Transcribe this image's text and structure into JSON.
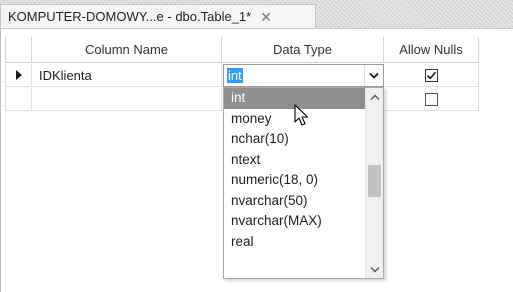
{
  "tab": {
    "title": "KOMPUTER-DOMOWY...e - dbo.Table_1*",
    "close_glyph": "✕"
  },
  "grid": {
    "headers": {
      "column_name": "Column Name",
      "data_type": "Data Type",
      "allow_nulls": "Allow Nulls"
    },
    "rows": [
      {
        "name": "IDKlienta",
        "data_type": "int",
        "allow_nulls": true,
        "current": true
      },
      {
        "name": "",
        "data_type": "",
        "allow_nulls": false,
        "current": false
      }
    ]
  },
  "dropdown": {
    "items": [
      "int",
      "money",
      "nchar(10)",
      "ntext",
      "numeric(18, 0)",
      "nvarchar(50)",
      "nvarchar(MAX)",
      "real"
    ],
    "highlighted": "int",
    "scroll_position": 0.48
  },
  "icons": {
    "row_indicator": "current-row-arrow-icon",
    "dropdown": "chevron-down-icon",
    "check": "checkmark-icon",
    "cursor": "mouse-pointer-icon"
  },
  "colors": {
    "selection": "#3399ff",
    "hover_item": "#8f8f8f"
  }
}
